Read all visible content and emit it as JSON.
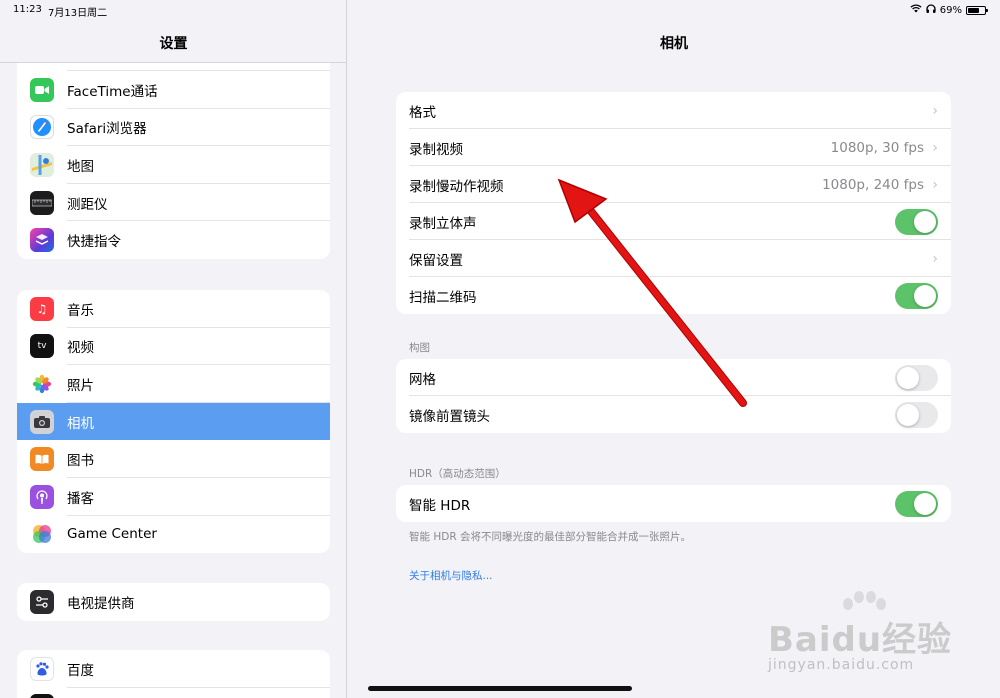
{
  "status_bar": {
    "time": "11:23",
    "date": "7月13日周二",
    "battery": "69%"
  },
  "sidebar": {
    "title": "设置",
    "groups": [
      {
        "items": [
          {
            "label": "FaceTime通话",
            "icon": "facetime-icon",
            "color": "#34c759"
          },
          {
            "label": "Safari浏览器",
            "icon": "safari-icon",
            "color": "#1e90ff"
          },
          {
            "label": "地图",
            "icon": "maps-icon",
            "color": "#7fc86a"
          },
          {
            "label": "测距仪",
            "icon": "measure-icon",
            "color": "#1c1c1e"
          },
          {
            "label": "快捷指令",
            "icon": "shortcuts-icon",
            "color": "#3a3a8c"
          }
        ]
      },
      {
        "items": [
          {
            "label": "音乐",
            "icon": "music-icon",
            "color": "#fc3c44"
          },
          {
            "label": "视频",
            "icon": "tv-icon",
            "color": "#111111"
          },
          {
            "label": "照片",
            "icon": "photos-icon",
            "color": "#f7b731"
          },
          {
            "label": "相机",
            "icon": "camera-icon",
            "color": "#8e8e93"
          },
          {
            "label": "图书",
            "icon": "books-icon",
            "color": "#f08a24"
          },
          {
            "label": "播客",
            "icon": "podcasts-icon",
            "color": "#9b51e0"
          },
          {
            "label": "Game Center",
            "icon": "game-center-icon",
            "color": "#e84393"
          }
        ]
      },
      {
        "items": [
          {
            "label": "电视提供商",
            "icon": "tv-provider-icon",
            "color": "#2c2c2e"
          }
        ]
      },
      {
        "items": [
          {
            "label": "百度",
            "icon": "baidu-icon",
            "color": "#ffffff"
          }
        ]
      }
    ]
  },
  "main": {
    "title": "相机",
    "group1": {
      "format": "格式",
      "record_video": "录制视频",
      "record_video_value": "1080p, 30 fps",
      "record_slomo": "录制慢动作视频",
      "record_slomo_value": "1080p, 240 fps",
      "record_stereo": "录制立体声",
      "preserve_settings": "保留设置",
      "scan_qr": "扫描二维码"
    },
    "composition": {
      "header": "构图",
      "grid": "网格",
      "mirror_front": "镜像前置镜头"
    },
    "hdr": {
      "header": "HDR（高动态范围）",
      "smart_hdr": "智能 HDR",
      "footnote": "智能 HDR 会将不同曝光度的最佳部分智能合并成一张照片。"
    },
    "privacy_link": "关于相机与隐私..."
  },
  "toggles": {
    "record_stereo": true,
    "scan_qr": true,
    "grid": false,
    "mirror_front": false,
    "smart_hdr": true
  },
  "watermark": {
    "brand": "Baidu经验",
    "url": "jingyan.baidu.com"
  }
}
